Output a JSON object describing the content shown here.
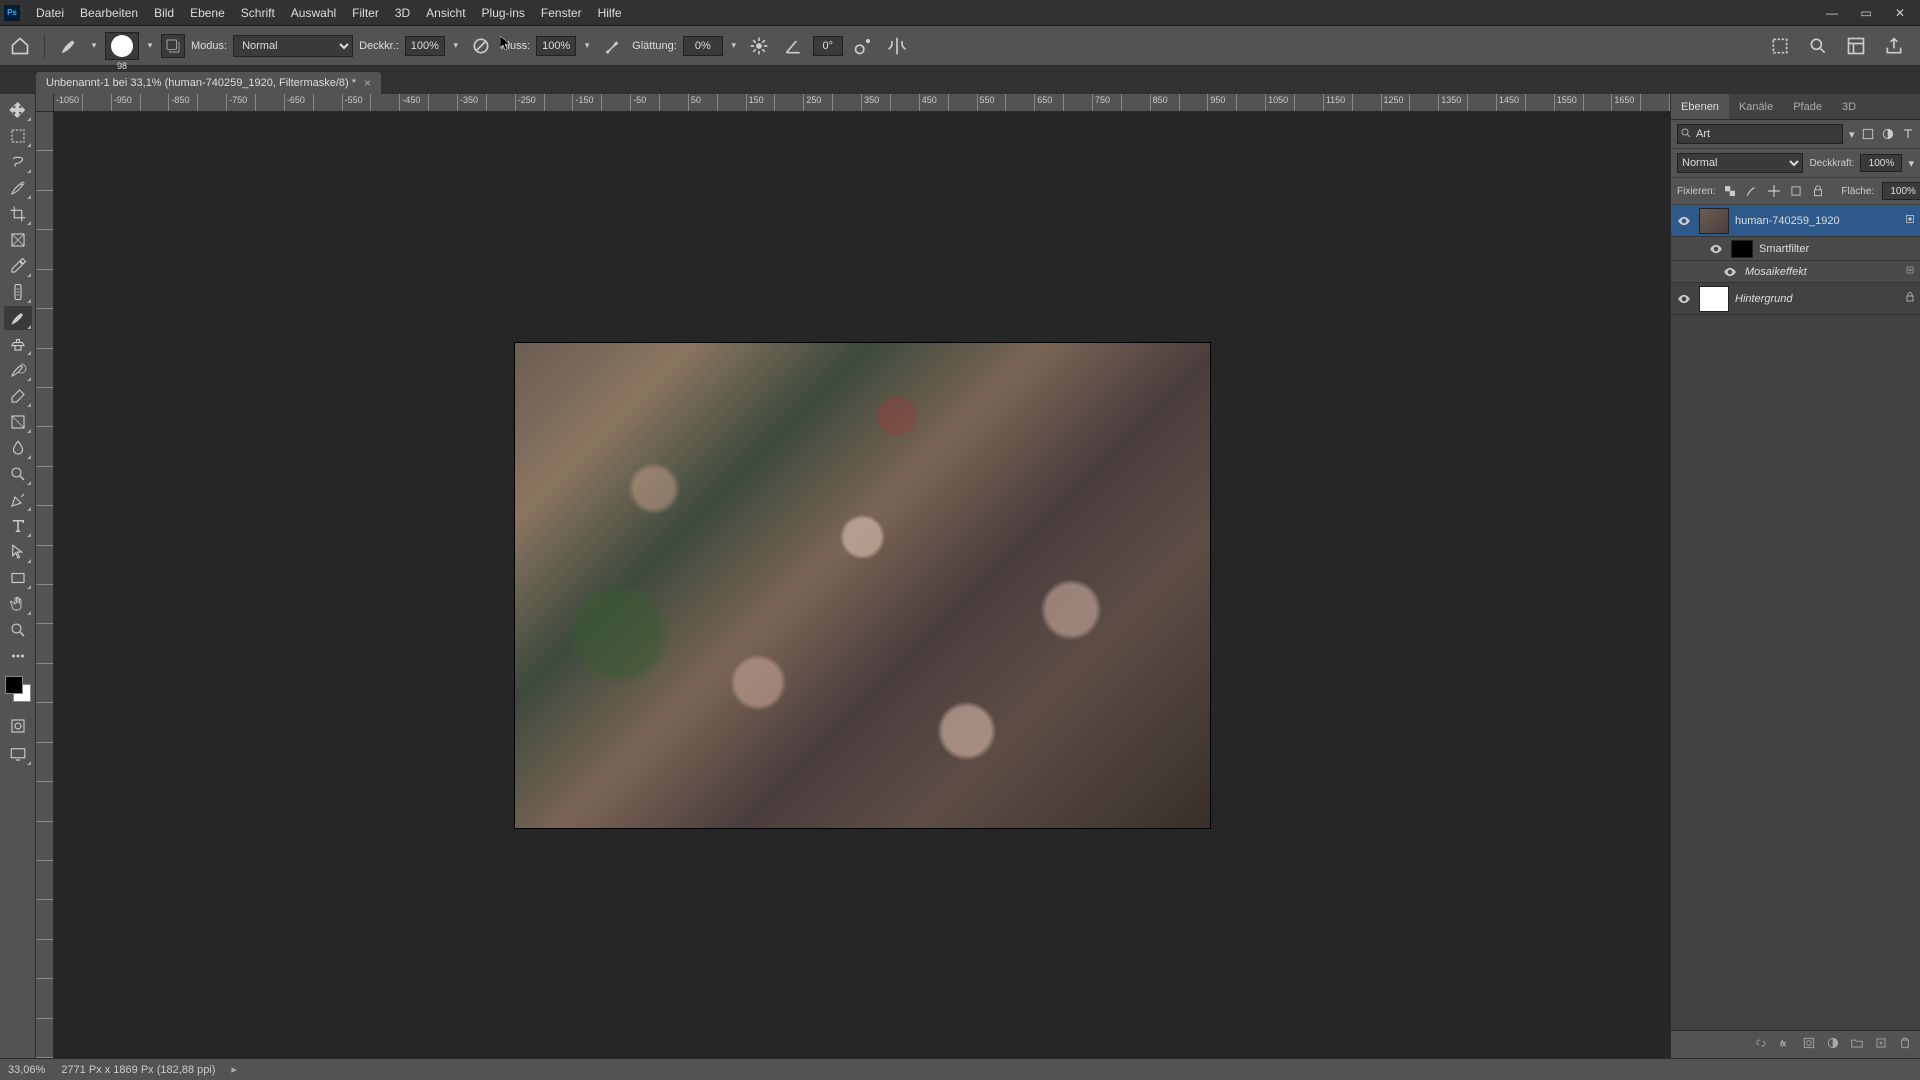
{
  "menu": {
    "items": [
      "Datei",
      "Bearbeiten",
      "Bild",
      "Ebene",
      "Schrift",
      "Auswahl",
      "Filter",
      "3D",
      "Ansicht",
      "Plug-ins",
      "Fenster",
      "Hilfe"
    ]
  },
  "options": {
    "brush_size": "98",
    "mode_label": "Modus:",
    "mode_value": "Normal",
    "opacity_label": "Deckkr.:",
    "opacity_value": "100%",
    "flow_label": "Fluss:",
    "flow_value": "100%",
    "smoothing_label": "Glättung:",
    "smoothing_value": "0%",
    "angle_value": "0°"
  },
  "doc_tab": {
    "title": "Unbenannt-1 bei 33,1% (human-740259_1920, Filtermaske/8) *"
  },
  "ruler_h_start": -1050,
  "ruler_h_step": 50,
  "ruler_h_count": 56,
  "ruler_v_start": 0,
  "panels": {
    "tabs": [
      "Ebenen",
      "Kanäle",
      "Pfade",
      "3D"
    ],
    "search_placeholder": "Art",
    "blend_mode": "Normal",
    "opacity_label": "Deckkraft:",
    "opacity_value": "100%",
    "lock_label": "Fixieren:",
    "fill_label": "Fläche:",
    "fill_value": "100%",
    "layers": [
      {
        "name": "human-740259_1920",
        "selected": true,
        "thumb": "img",
        "smart": true
      },
      {
        "name": "Smartfilter",
        "sub": true,
        "thumb": "black"
      },
      {
        "name": "Mosaikeffekt",
        "sub2": true
      },
      {
        "name": "Hintergrund",
        "thumb": "white",
        "italic": true,
        "locked": true
      }
    ]
  },
  "status": {
    "zoom": "33,06%",
    "info": "2771 Px x 1869 Px (182,88 ppi)"
  }
}
